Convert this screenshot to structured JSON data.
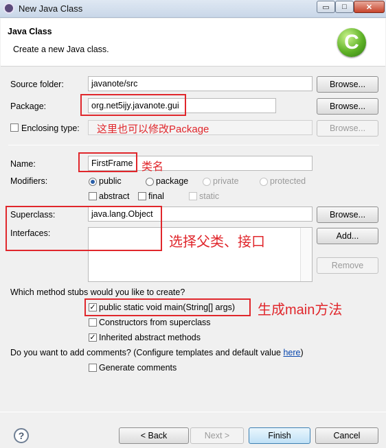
{
  "window": {
    "title": "New Java Class",
    "minimize_glyph": "▭",
    "maximize_glyph": "□",
    "close_glyph": "✕"
  },
  "header": {
    "title": "Java Class",
    "subtitle": "Create a new Java class.",
    "logo_letter": "C"
  },
  "source_folder": {
    "label": "Source folder:",
    "value": "javanote/src",
    "browse_label": "Browse..."
  },
  "package": {
    "label": "Package:",
    "value": "org.net5ijy.javanote.gui",
    "browse_label": "Browse..."
  },
  "enclosing": {
    "label": "Enclosing type:",
    "browse_label": "Browse...",
    "checked": false
  },
  "name": {
    "label": "Name:",
    "value": "FirstFrame"
  },
  "modifiers": {
    "label": "Modifiers:",
    "access": [
      {
        "label": "public",
        "selected": true,
        "enabled": true
      },
      {
        "label": "package",
        "selected": false,
        "enabled": true
      },
      {
        "label": "private",
        "selected": false,
        "enabled": false
      },
      {
        "label": "protected",
        "selected": false,
        "enabled": false
      }
    ],
    "flags": [
      {
        "label": "abstract",
        "checked": false,
        "enabled": true
      },
      {
        "label": "final",
        "checked": false,
        "enabled": true
      },
      {
        "label": "static",
        "checked": false,
        "enabled": false
      }
    ]
  },
  "superclass": {
    "label": "Superclass:",
    "value": "java.lang.Object",
    "browse_label": "Browse..."
  },
  "interfaces": {
    "label": "Interfaces:",
    "add_label": "Add...",
    "remove_label": "Remove"
  },
  "stubs": {
    "question": "Which method stubs would you like to create?",
    "options": [
      {
        "label": "public static void main(String[] args)",
        "checked": true
      },
      {
        "label": "Constructors from superclass",
        "checked": false
      },
      {
        "label": "Inherited abstract methods",
        "checked": true
      }
    ]
  },
  "comments": {
    "question_prefix": "Do you want to add comments? (Configure templates and default value ",
    "link": "here",
    "question_suffix": ")",
    "option_label": "Generate comments",
    "checked": false
  },
  "footer": {
    "help_glyph": "?",
    "back_label": "< Back",
    "next_label": "Next >",
    "finish_label": "Finish",
    "cancel_label": "Cancel"
  },
  "annotations": {
    "package_note": "这里也可以修改Package",
    "name_note": "类名",
    "superclass_note": "选择父类、接口",
    "main_note": "生成main方法"
  },
  "colors": {
    "annotation_red": "#e0262b",
    "link_blue": "#0645ad",
    "logo_green": "#5fb227"
  }
}
